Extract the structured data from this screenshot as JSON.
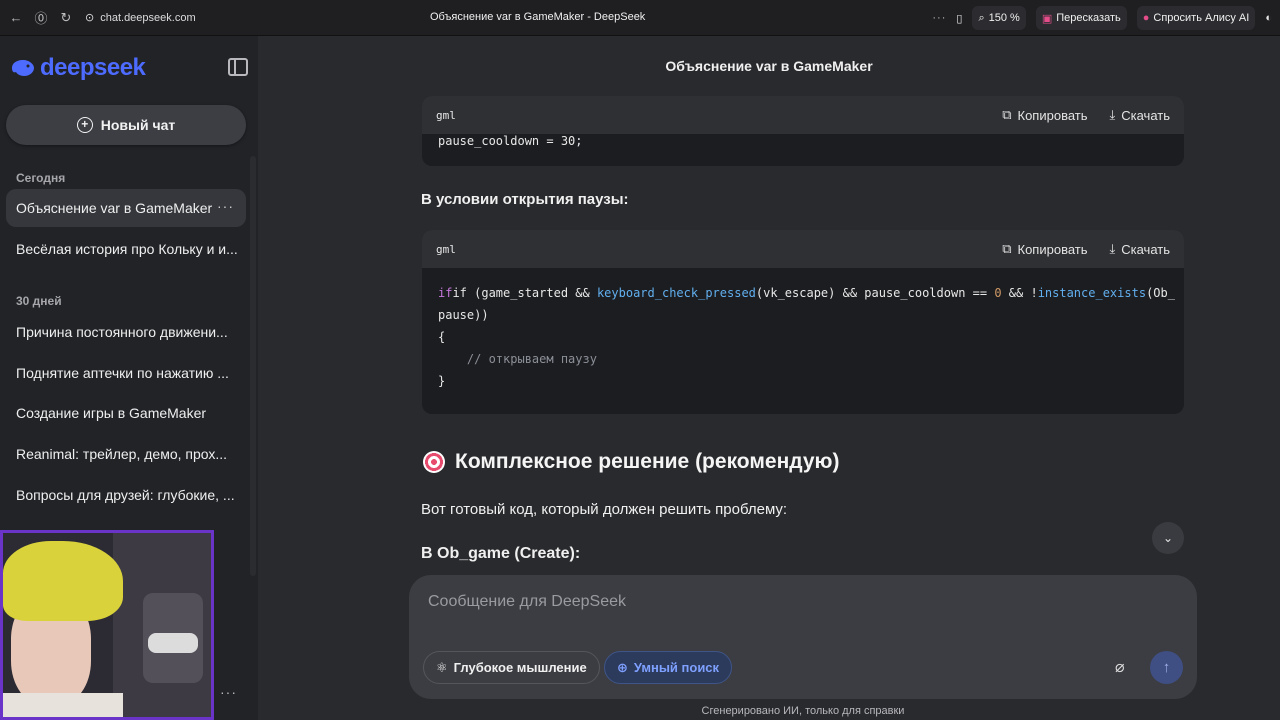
{
  "browser": {
    "url": "chat.deepseek.com",
    "tab_title": "Объяснение var в GameMaker - DeepSeek",
    "zoom": "150 %",
    "retell": "Пересказать",
    "ask_alice": "Спросить Алису AI"
  },
  "sidebar": {
    "logo": "deepseek",
    "new_chat": "Новый чат",
    "section_today": "Сегодня",
    "section_30days": "30 дней",
    "today_items": [
      {
        "label": "Объяснение var в GameMaker"
      },
      {
        "label": "Весёлая история про Кольку и и..."
      }
    ],
    "month_items": [
      {
        "label": "Причина постоянного движени..."
      },
      {
        "label": "Поднятие аптечки по нажатию ..."
      },
      {
        "label": "Создание игры в GameMaker"
      },
      {
        "label": "Reanimal: трейлер, демо, прох..."
      },
      {
        "label": "Вопросы для друзей: глубокие, ..."
      }
    ]
  },
  "main": {
    "chat_title": "Объяснение var в GameMaker",
    "code_block_1": {
      "lang": "gml",
      "copy": "Копировать",
      "download": "Скачать",
      "code": "pause_cooldown = 30;"
    },
    "pause_condition_label": "В условии открытия паузы:",
    "code_block_2": {
      "lang": "gml",
      "copy": "Копировать",
      "download": "Скачать",
      "line1_a": "if (game_started && ",
      "line1_fn": "keyboard_check_pressed",
      "line1_b": "(vk_escape) && pause_cooldown == ",
      "line1_num": "0",
      "line1_c": " && !",
      "line1_fn2": "instance_exists",
      "line1_d": "(Ob_",
      "line2": "pause))",
      "line3": "{",
      "line4": "    // открываем паузу",
      "line5": "}"
    },
    "heading": "Комплексное решение (рекомендую)",
    "intro": "Вот готовый код, который должен решить проблему:",
    "create_label": "В Ob_game (Create):"
  },
  "composer": {
    "placeholder": "Сообщение для DeepSeek",
    "deep_thinking": "Глубокое мышление",
    "smart_search": "Умный поиск"
  },
  "footer_note": "Сгенерировано ИИ, только для справки"
}
